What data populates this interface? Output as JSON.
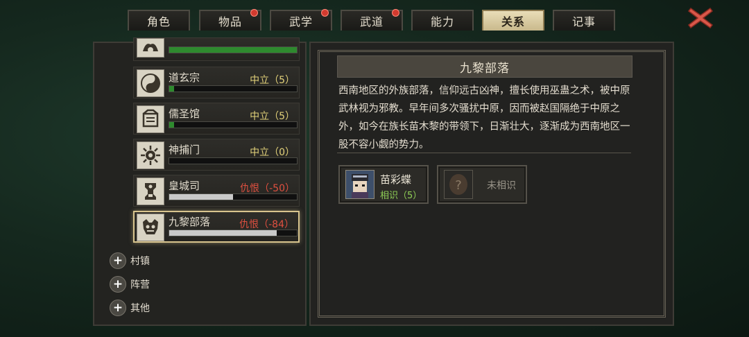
{
  "tabs": [
    {
      "label": "角色",
      "badge": false
    },
    {
      "label": "物品",
      "badge": true
    },
    {
      "label": "武学",
      "badge": true
    },
    {
      "label": "武道",
      "badge": true
    },
    {
      "label": "能力",
      "badge": false
    },
    {
      "label": "关系",
      "badge": false,
      "active": true
    },
    {
      "label": "记事",
      "badge": false
    }
  ],
  "close_icon": "close-x-icon",
  "factions": [
    {
      "name": "",
      "status": "",
      "fill": 1.0,
      "bar_color": "#2e8a2e",
      "icon": "lotus-emblem-icon"
    },
    {
      "name": "道玄宗",
      "status": "中立（5）",
      "fill": 0.04,
      "bar_color": "#2e8a2e",
      "icon": "taiji-emblem-icon"
    },
    {
      "name": "儒圣馆",
      "status": "中立（5）",
      "fill": 0.04,
      "bar_color": "#2e8a2e",
      "icon": "scroll-emblem-icon"
    },
    {
      "name": "神捕门",
      "status": "中立（0）",
      "fill": 0.0,
      "bar_color": "#2e8a2e",
      "icon": "sun-emblem-icon"
    },
    {
      "name": "皇城司",
      "status": "仇恨（-50）",
      "fill": 0.5,
      "bar_color": "#c9c9c9",
      "icon": "guardian-emblem-icon"
    },
    {
      "name": "九黎部落",
      "status": "仇恨（-84）",
      "fill": 0.84,
      "bar_color": "#c9c9c9",
      "icon": "demon-mask-emblem-icon",
      "selected": true
    }
  ],
  "categories": [
    "村镇",
    "阵营",
    "其他"
  ],
  "detail": {
    "title": "九黎部落",
    "description": "西南地区的外族部落，信仰远古凶神，擅长使用巫蛊之术，被中原武林视为邪教。早年间多次骚扰中原，因而被赵国隔绝于中原之外，如今在族长苗木黎的带领下，日渐壮大，逐渐成为西南地区一股不容小觑的势力。",
    "members": [
      {
        "name": "苗彩蝶",
        "relation": "相识（5）",
        "portrait": "character-portrait-icon"
      },
      {
        "name": "未相识",
        "relation": "",
        "portrait": "unknown-portrait-icon"
      }
    ]
  },
  "colors": {
    "neutral": "#e3d27a",
    "hostile": "#e05040",
    "acquainted": "#8fcf56",
    "accent": "#d8c48e"
  }
}
